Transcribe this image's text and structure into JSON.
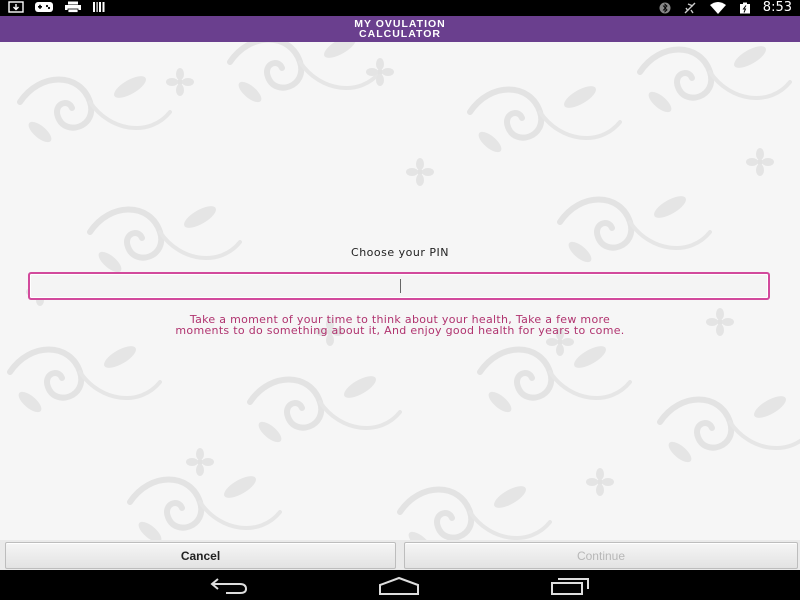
{
  "status_bar": {
    "time": "8:53",
    "left_icons": [
      "download-icon",
      "gamepad-icon",
      "printer-icon",
      "barcode-icon"
    ],
    "right_icons": [
      "bluetooth-icon",
      "airplane-icon",
      "wifi-icon",
      "battery-icon"
    ]
  },
  "header": {
    "title": "MY OVULATION\nCALCULATOR",
    "color": "#6a3f8e"
  },
  "pin": {
    "label": "Choose your PIN",
    "value": "",
    "placeholder": "",
    "border_color": "#d24a9c"
  },
  "quote": {
    "text": "Take a moment of your time to think about your health, Take a few more moments to do something about it, And enjoy good health for years to come.",
    "color": "#b0336f"
  },
  "buttons": {
    "cancel_label": "Cancel",
    "continue_label": "Continue"
  },
  "nav": {
    "icons": [
      "back-icon",
      "home-icon",
      "recents-icon"
    ]
  }
}
